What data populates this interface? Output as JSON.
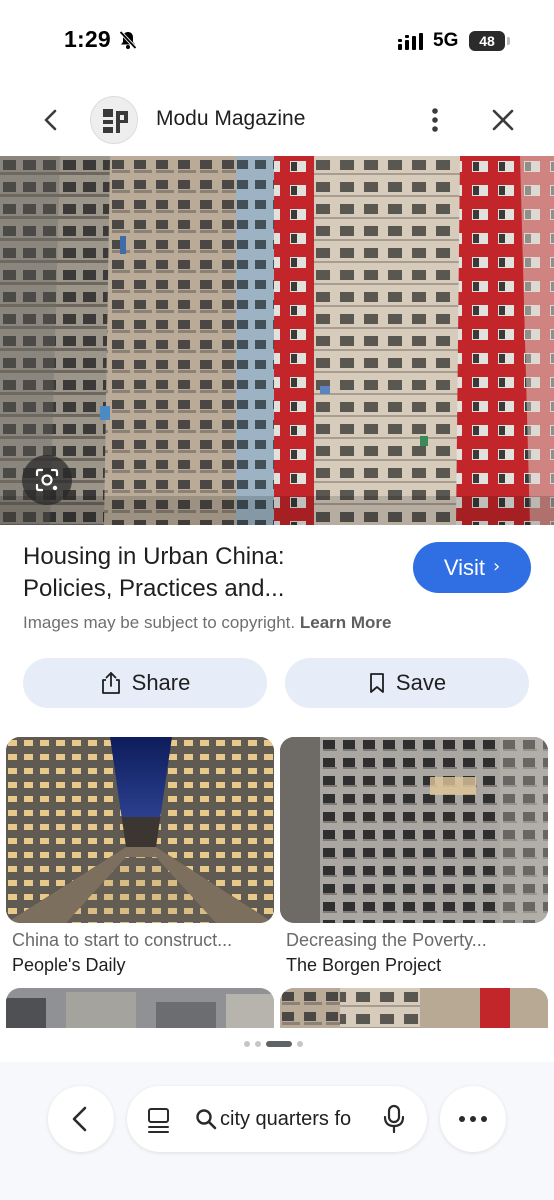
{
  "status_bar": {
    "time": "1:29",
    "network": "5G",
    "battery": "48",
    "icons": [
      "bell-muted-icon",
      "signal-icon",
      "battery-icon"
    ]
  },
  "header": {
    "site_name": "Modu Magazine",
    "icons": [
      "chevron-left-icon",
      "site-logo",
      "more-vertical-icon",
      "close-icon"
    ]
  },
  "result": {
    "title_line1": "Housing in Urban China:",
    "title_line2": "Policies, Practices and...",
    "visit_label": "Visit",
    "copyright_text": "Images may be subject to copyright.",
    "learn_more": "Learn More",
    "share_label": "Share",
    "save_label": "Save"
  },
  "related": [
    {
      "title": "China to start to construct...",
      "source": "People's Daily"
    },
    {
      "title": "Decreasing the Poverty...",
      "source": "The Borgen Project"
    }
  ],
  "pagination": {
    "total": 4,
    "active": 2
  },
  "bottom_bar": {
    "search_value": "city quarters fo",
    "icons": [
      "chevron-left-icon",
      "tabs-icon",
      "search-icon",
      "mic-icon",
      "more-horizontal-icon"
    ]
  },
  "colors": {
    "accent": "#2f6fe3",
    "action_button_bg": "#e6ecf8",
    "secondary_text": "#6f6f6f"
  }
}
